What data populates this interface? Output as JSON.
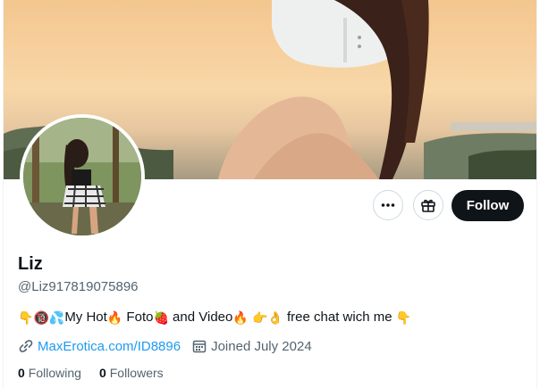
{
  "profile": {
    "name": "Liz",
    "handle": "@Liz917819075896",
    "bio": {
      "parts": [
        {
          "type": "emoji",
          "icon": "pointing-down-icon",
          "glyph": "👇"
        },
        {
          "type": "emoji",
          "icon": "no-under-18-icon",
          "glyph": "🔞"
        },
        {
          "type": "emoji",
          "icon": "sweat-droplets-icon",
          "glyph": "💦"
        },
        {
          "type": "text",
          "value": "My Hot"
        },
        {
          "type": "emoji",
          "icon": "fire-icon",
          "glyph": "🔥"
        },
        {
          "type": "text",
          "value": " Foto"
        },
        {
          "type": "emoji",
          "icon": "strawberry-icon",
          "glyph": "🍓"
        },
        {
          "type": "text",
          "value": " and Video"
        },
        {
          "type": "emoji",
          "icon": "fire-icon",
          "glyph": "🔥"
        },
        {
          "type": "text",
          "value": " "
        },
        {
          "type": "emoji",
          "icon": "pointing-right-icon",
          "glyph": "👉"
        },
        {
          "type": "emoji",
          "icon": "ok-hand-icon",
          "glyph": "👌"
        },
        {
          "type": "text",
          "value": " free chat wich me "
        },
        {
          "type": "emoji",
          "icon": "pointing-down-icon",
          "glyph": "👇"
        }
      ]
    },
    "link_text": "MaxErotica.com/ID8896",
    "joined": "Joined July 2024",
    "following_count": "0",
    "following_label": "Following",
    "followers_count": "0",
    "followers_label": "Followers"
  },
  "actions": {
    "follow_label": "Follow",
    "more_icon": "more-icon",
    "gift_icon": "gift-icon"
  },
  "colors": {
    "link": "#1d9bf0",
    "secondary_text": "#536471",
    "follow_bg": "#0f1419"
  }
}
